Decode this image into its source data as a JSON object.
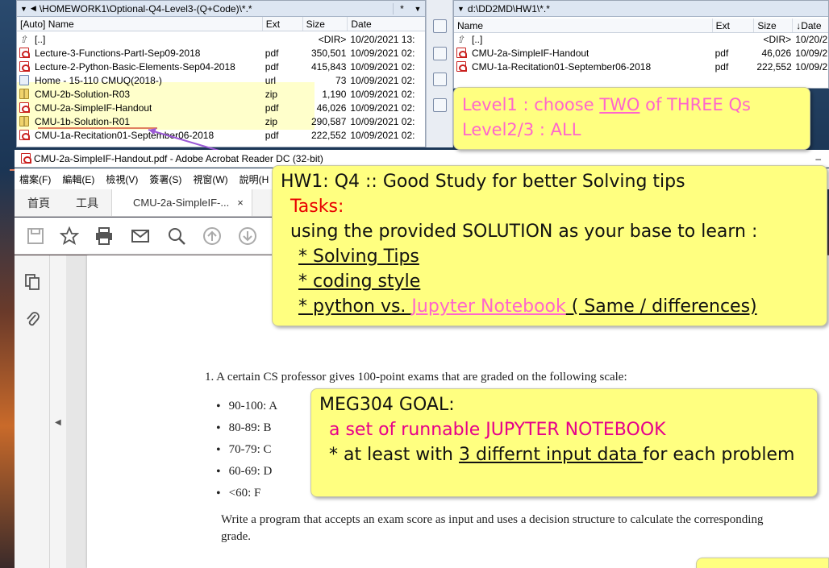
{
  "left_panel": {
    "path": "\\HOMEWORK1\\Optional-Q4-Level3-(Q+Code)\\*.*",
    "star": "*",
    "columns": [
      "[Auto] Name",
      "Ext",
      "Size",
      "Date"
    ],
    "rows": [
      {
        "icon": "up",
        "name": "[..]",
        "ext": "",
        "size": "<DIR>",
        "date": "10/20/2021 13:"
      },
      {
        "icon": "pdf",
        "name": "Lecture-3-Functions-PartI-Sep09-2018",
        "ext": "pdf",
        "size": "350,501",
        "date": "10/09/2021 02:"
      },
      {
        "icon": "pdf",
        "name": "Lecture-2-Python-Basic-Elements-Sep04-2018",
        "ext": "pdf",
        "size": "415,843",
        "date": "10/09/2021 02:"
      },
      {
        "icon": "url",
        "name": "Home - 15-110 CMUQ(2018-)",
        "ext": "url",
        "size": "73",
        "date": "10/09/2021 02:"
      },
      {
        "icon": "zip",
        "name": "CMU-2b-Solution-R03",
        "ext": "zip",
        "size": "1,190",
        "date": "10/09/2021 02:"
      },
      {
        "icon": "pdf",
        "name": "CMU-2a-SimpleIF-Handout",
        "ext": "pdf",
        "size": "46,026",
        "date": "10/09/2021 02:"
      },
      {
        "icon": "zip",
        "name": "CMU-1b-Solution-R01",
        "ext": "zip",
        "size": "290,587",
        "date": "10/09/2021 02:"
      },
      {
        "icon": "pdf",
        "name": "CMU-1a-Recitation01-September06-2018",
        "ext": "pdf",
        "size": "222,552",
        "date": "10/09/2021 02:"
      }
    ]
  },
  "right_panel": {
    "path": "d:\\DD2MD\\HW1\\*.*",
    "columns": [
      "Name",
      "Ext",
      "Size",
      "↓Date"
    ],
    "rows": [
      {
        "icon": "up",
        "name": "[..]",
        "ext": "",
        "size": "<DIR>",
        "date": "10/20/2"
      },
      {
        "icon": "pdf",
        "name": "CMU-2a-SimpleIF-Handout",
        "ext": "pdf",
        "size": "46,026",
        "date": "10/09/2"
      },
      {
        "icon": "pdf",
        "name": "CMU-1a-Recitation01-September06-2018",
        "ext": "pdf",
        "size": "222,552",
        "date": "10/09/2"
      }
    ]
  },
  "acrobat": {
    "title": "CMU-2a-SimpleIF-Handout.pdf - Adobe Acrobat Reader DC (32-bit)",
    "minimize": "–",
    "menu": [
      "檔案(F)",
      "編輯(E)",
      "檢視(V)",
      "簽署(S)",
      "視窗(W)",
      "說明(H"
    ],
    "tabs": {
      "home": "首頁",
      "tools": "工具",
      "doc": "CMU-2a-SimpleIF-...",
      "close": "×"
    }
  },
  "pdf_page": {
    "problem": "1.  A certain CS professor gives 100-point exams that are graded on the following scale:",
    "grades": [
      "90-100:  A",
      "80-89:  B",
      "70-79:  C",
      "60-69:  D",
      "<60:  F"
    ],
    "paragraph": "Write a program that accepts an exam score as input and uses a decision structure to calculate the corresponding grade."
  },
  "notes": {
    "level": {
      "line1_a": "Level1 : choose ",
      "line1_u": "TWO",
      "line1_b": " of THREE Qs",
      "line2": "Level2/3 : ALL"
    },
    "hw1": {
      "title": "HW1:  Q4  :: Good Study for better Solving tips",
      "tasks": "Tasks:",
      "base": "using the provided SOLUTION as your base to learn :",
      "item1": "* Solving Tips ",
      "item2": "* coding style ",
      "item3_a": "* python vs. ",
      "item3_b": "Jupyter Notebook",
      "item3_c": " ( Same / differences)"
    },
    "goal": {
      "title": "MEG304 GOAL:",
      "line1": "a set of runnable JUPYTER NOTEBOOK",
      "line2_a": "* at least with ",
      "line2_u": "3 differnt input data ",
      "line2_b": "for each problem"
    }
  },
  "colors": {
    "note": "#ffff80",
    "note_pink": "#ff66cc",
    "task_red": "#e80000",
    "goal_magenta": "#e6008a"
  }
}
